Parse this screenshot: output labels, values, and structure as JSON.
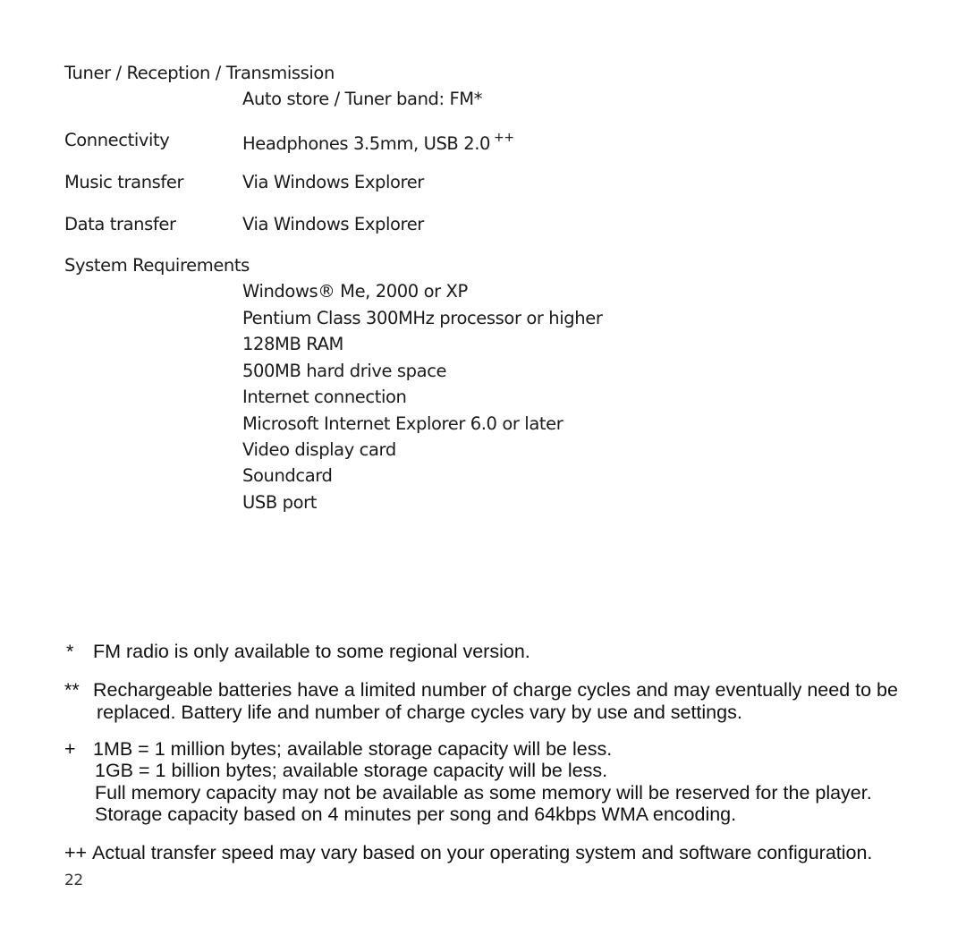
{
  "specs": {
    "tuner": {
      "label": "Tuner / Reception / Transmission",
      "value": "Auto store / Tuner band: FM*"
    },
    "connectivity": {
      "label": "Connectivity",
      "value": "Headphones 3.5mm, USB 2.0",
      "mark": "++"
    },
    "music_transfer": {
      "label": "Music transfer",
      "value": "Via Windows Explorer"
    },
    "data_transfer": {
      "label": "Data transfer",
      "value": "Via Windows Explorer"
    },
    "system_requirements": {
      "label": "System Requirements",
      "items": [
        "Windows® Me, 2000 or XP",
        "Pentium Class 300MHz processor or higher",
        "128MB RAM",
        "500MB hard drive space",
        "Internet connection",
        "Microsoft Internet Explorer 6.0 or later",
        "Video display card",
        "Soundcard",
        "USB port"
      ]
    }
  },
  "footnotes": [
    {
      "symbol": "*",
      "lines": [
        "FM radio is only available to some regional version."
      ]
    },
    {
      "symbol": "**",
      "lines": [
        "Rechargeable batteries have a limited number of charge cycles and may eventually need to be",
        "replaced. Battery life and number of charge cycles vary by use and settings."
      ]
    },
    {
      "symbol": "+",
      "lines": [
        "1MB = 1 million bytes; available storage capacity will be less.",
        "1GB = 1 billion bytes; available storage capacity will be less.",
        "Full memory capacity may not be available as some memory will be reserved for the player.",
        "Storage capacity based on 4 minutes per song and 64kbps WMA encoding."
      ]
    },
    {
      "symbol": "++",
      "lines": [
        "Actual transfer speed may vary based on your operating system and software configuration."
      ]
    }
  ],
  "page_number": "22"
}
